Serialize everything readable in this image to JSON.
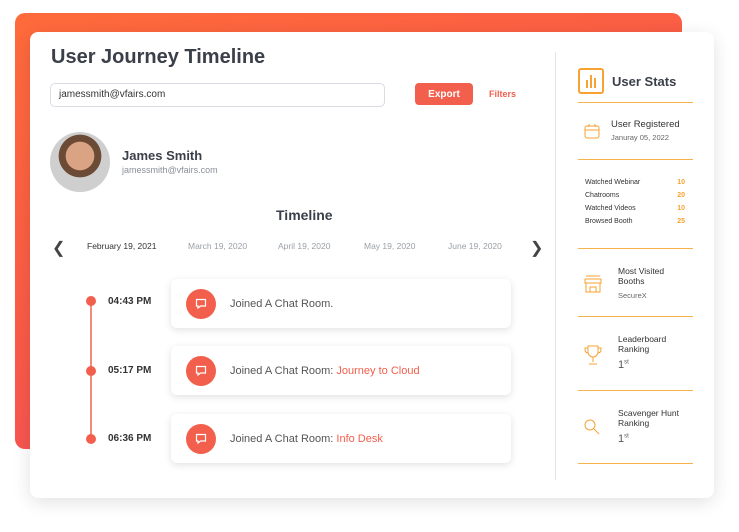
{
  "title": "User Journey Timeline",
  "search": {
    "value": "jamessmith@vfairs.com"
  },
  "toolbar": {
    "export_label": "Export",
    "filters_label": "Filters"
  },
  "user": {
    "name": "James Smith",
    "email": "jamessmith@vfairs.com"
  },
  "timeline": {
    "title": "Timeline",
    "dates": [
      "February 19, 2021",
      "March 19, 2020",
      "April  19, 2020",
      "May  19, 2020",
      "June 19, 2020"
    ],
    "events": [
      {
        "time": "04:43 PM",
        "text": "Joined A Chat Room.",
        "highlight": ""
      },
      {
        "time": "05:17 PM",
        "text": "Joined A Chat Room: ",
        "highlight": "Journey to Cloud"
      },
      {
        "time": "06:36 PM",
        "text": "Joined A Chat Room: ",
        "highlight": "Info Desk"
      }
    ]
  },
  "stats": {
    "title": "User Stats",
    "registered_label": "User Registered",
    "registered_date": "Januray 05, 2022",
    "counts": [
      {
        "label": "Watched Webinar",
        "value": "10"
      },
      {
        "label": "Chatrooms",
        "value": "20"
      },
      {
        "label": "Watched Videos",
        "value": "10"
      },
      {
        "label": "Browsed Booth",
        "value": "25"
      }
    ],
    "booth_label": "Most Visited Booths",
    "booth_value": "SecureX",
    "leaderboard_label": "Leaderboard Ranking",
    "leaderboard_value": "1",
    "leaderboard_suffix": "st",
    "hunt_label": "Scavenger Hunt Ranking",
    "hunt_value": "1",
    "hunt_suffix": "st"
  },
  "colors": {
    "accent": "#f25f4c",
    "stats": "#f7a233"
  }
}
